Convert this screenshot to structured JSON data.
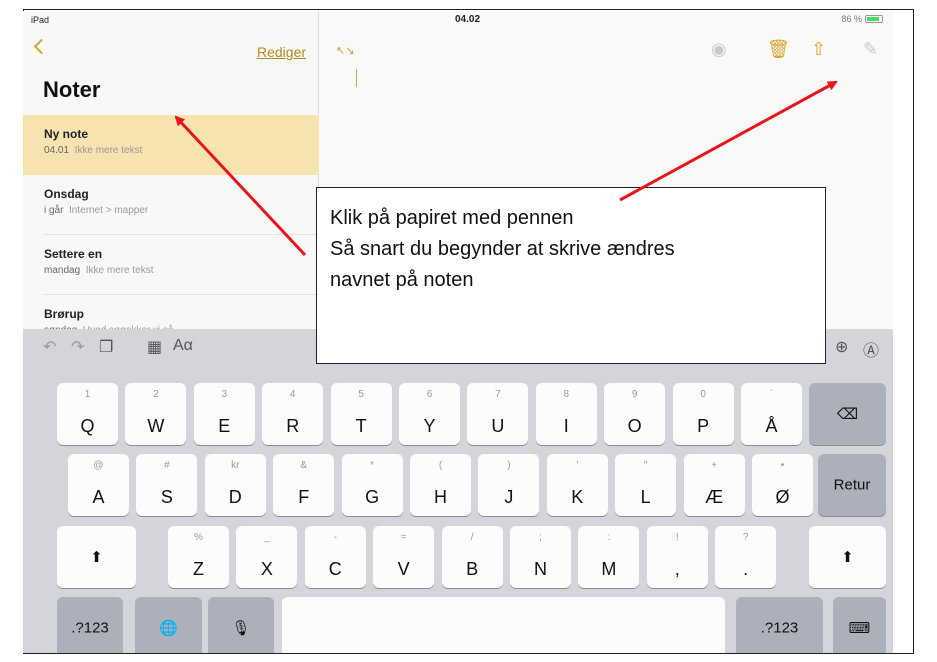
{
  "status": {
    "device": "iPad",
    "time": "04.02",
    "battery": "86 %"
  },
  "sidebar": {
    "edit_label": "Rediger",
    "title": "Noter",
    "notes": [
      {
        "title": "Ny note",
        "date": "04.01",
        "preview": "Ikke mere tekst"
      },
      {
        "title": "Onsdag",
        "date": "i går",
        "preview": "Internet > mapper"
      },
      {
        "title": "Settere en",
        "date": "mandag",
        "preview": "Ikke mere tekst"
      },
      {
        "title": "Brørup",
        "date": "søndag",
        "preview": "Hvad søgekker vi så"
      }
    ]
  },
  "keyboard": {
    "format_label": "Aα",
    "row1": [
      {
        "hint": "1",
        "key": "Q"
      },
      {
        "hint": "2",
        "key": "W"
      },
      {
        "hint": "3",
        "key": "E"
      },
      {
        "hint": "4",
        "key": "R"
      },
      {
        "hint": "5",
        "key": "T"
      },
      {
        "hint": "6",
        "key": "Y"
      },
      {
        "hint": "7",
        "key": "U"
      },
      {
        "hint": "8",
        "key": "I"
      },
      {
        "hint": "9",
        "key": "O"
      },
      {
        "hint": "0",
        "key": "P"
      },
      {
        "hint": "`",
        "key": "Å"
      }
    ],
    "row2": [
      {
        "hint": "@",
        "key": "A"
      },
      {
        "hint": "#",
        "key": "S"
      },
      {
        "hint": "kr",
        "key": "D"
      },
      {
        "hint": "&",
        "key": "F"
      },
      {
        "hint": "*",
        "key": "G"
      },
      {
        "hint": "(",
        "key": "H"
      },
      {
        "hint": ")",
        "key": "J"
      },
      {
        "hint": "'",
        "key": "K"
      },
      {
        "hint": "\"",
        "key": "L"
      },
      {
        "hint": "+",
        "key": "Æ"
      },
      {
        "hint": "•",
        "key": "Ø"
      }
    ],
    "row3": [
      {
        "hint": "%",
        "key": "Z"
      },
      {
        "hint": "_",
        "key": "X"
      },
      {
        "hint": "-",
        "key": "C"
      },
      {
        "hint": "=",
        "key": "V"
      },
      {
        "hint": "/",
        "key": "B"
      },
      {
        "hint": ";",
        "key": "N"
      },
      {
        "hint": ":",
        "key": "M"
      },
      {
        "hint": "!",
        "key": ","
      },
      {
        "hint": "?",
        "key": "."
      }
    ],
    "return_label": "Retur",
    "numbers_label": ".?123"
  },
  "callout": {
    "lines": [
      "Klik på papiret med pennen",
      "Så snart du begynder at skrive ændres",
      "navnet på noten"
    ]
  },
  "colors": {
    "accent": "#d6a52c",
    "arrow": "#e8161b",
    "selected": "#f6e3b0",
    "keyboard": "#d3d5db"
  }
}
